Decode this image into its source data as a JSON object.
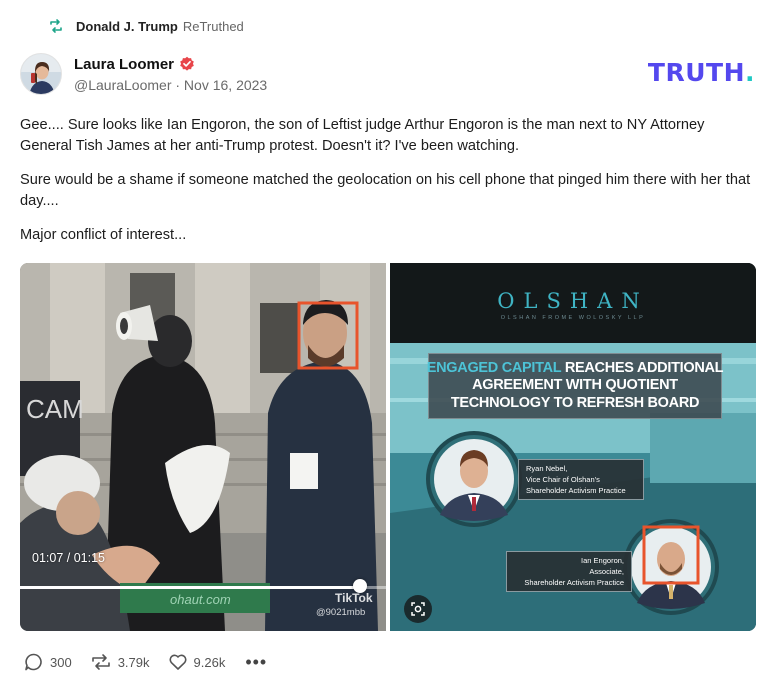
{
  "retruth": {
    "icon": "retruth-icon",
    "user": "Donald J. Trump",
    "label": "ReTruthed"
  },
  "post": {
    "author_name": "Laura Loomer",
    "handle_date": "@LauraLoomer · Nov 16, 2023",
    "verified_icon": "verified-badge-icon",
    "paragraphs": [
      "Gee.... Sure looks like Ian Engoron, the son of Leftist judge Arthur Engoron is the man next to NY Attorney General Tish James at her anti-Trump protest. Doesn't it? I've been watching.",
      "Sure would be a shame if someone matched the geolocation on his cell phone that pinged him there with her that day....",
      "Major conflict of interest..."
    ]
  },
  "brand": {
    "logo_main": "TRUTH",
    "logo_dot": ".",
    "color_purple": "#5448ee",
    "color_teal": "#1fc9c5",
    "verified_color": "#e8454a",
    "highlight_box_color": "#e8542c"
  },
  "media_left": {
    "sign_text": "CAM",
    "time": "01:07 / 01:15",
    "progress": 0.93,
    "tiktok": "TikTok",
    "tiktok_user": "@9021mbb",
    "watermark": "ohaut.com"
  },
  "media_right": {
    "firm": "OLSHAN",
    "firm_full": "OLSHAN FROME WOLOSKY LLP",
    "headline_highlight": "ENGAGED CAPITAL",
    "headline_line1_rest": " REACHES ADDITIONAL",
    "headline_line2": "AGREEMENT WITH QUOTIENT",
    "headline_line3": "TECHNOLOGY TO REFRESH BOARD",
    "person1_name": "Ryan Nebel,",
    "person1_title1": "Vice Chair of Olshan's",
    "person1_title2": "Shareholder Activism Practice",
    "person2_name": "Ian Engoron,",
    "person2_title1": "Associate,",
    "person2_title2": "Shareholder Activism Practice",
    "camera_icon": "lens-icon"
  },
  "actions": {
    "replies": "300",
    "retruths": "3.79k",
    "likes": "9.26k",
    "more": "•••"
  }
}
